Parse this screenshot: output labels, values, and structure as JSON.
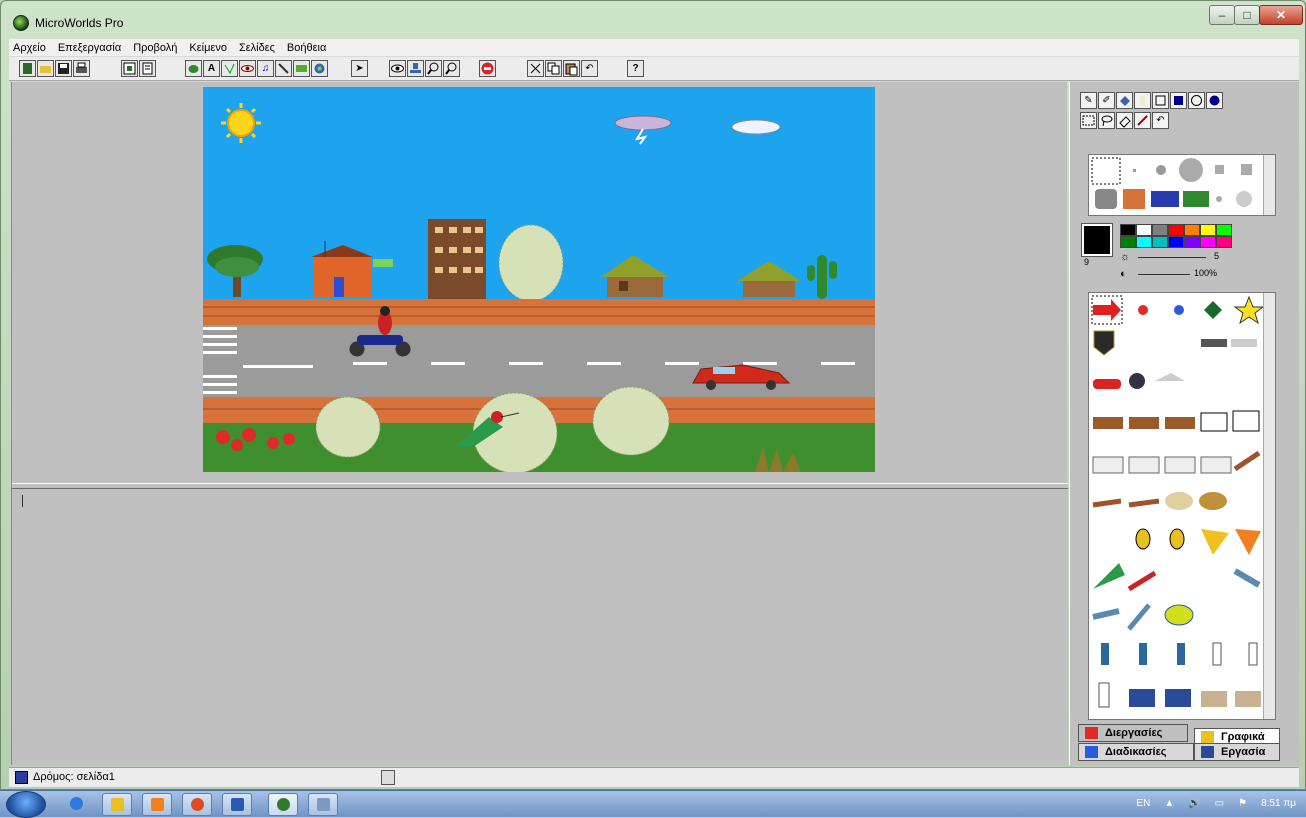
{
  "window": {
    "title": "MicroWorlds Pro",
    "min_glyph": "–",
    "max_glyph": "□",
    "close_glyph": "✕"
  },
  "menu": [
    "Αρχείο",
    "Επεξεργασία",
    "Προβολή",
    "Κείμενο",
    "Σελίδες",
    "Βοήθεια"
  ],
  "toolbar_icons": [
    "new-page-icon",
    "open-icon",
    "save-icon",
    "print-icon",
    "project-icon",
    "page-icon",
    "hatch-turtle-icon",
    "text-box-icon",
    "button-icon",
    "slider-icon",
    "music-icon",
    "sound-icon",
    "video-icon",
    "shapes-icon",
    "pointer-icon",
    "eye-icon",
    "stamp-icon",
    "zoom-in-icon",
    "zoom-out-icon",
    "stop-icon",
    "scissors-icon",
    "copy-icon",
    "paste-icon",
    "undo-icon",
    "help-icon"
  ],
  "paint_tools": [
    "pencil-icon",
    "brush-icon",
    "fill-bucket-icon",
    "spray-icon",
    "rectangle-icon",
    "filled-rectangle-icon",
    "oval-icon",
    "filled-oval-icon",
    "select-icon",
    "lasso-icon",
    "eraser-icon",
    "eyedropper-icon",
    "undo-icon"
  ],
  "palette": {
    "pen_size": "9",
    "brightness_value": "5",
    "opacity_value": "100%",
    "colors": [
      "#000000",
      "#ffffff",
      "#808080",
      "#ff0000",
      "#ff8000",
      "#ffff00",
      "#00ff00",
      "#008000",
      "#00ffff",
      "#00c0c0",
      "#0000ff",
      "#8000ff",
      "#ff00ff",
      "#ff0080"
    ]
  },
  "tabs": {
    "processes": "Διεργασίες",
    "graphics": "Γραφικά",
    "procedures": "Διαδικασίες",
    "project": "Εργασία"
  },
  "status": {
    "page": "Δρόμος: σελίδα1"
  },
  "taskbar": {
    "lang": "EN",
    "time": "8:51 πμ"
  }
}
